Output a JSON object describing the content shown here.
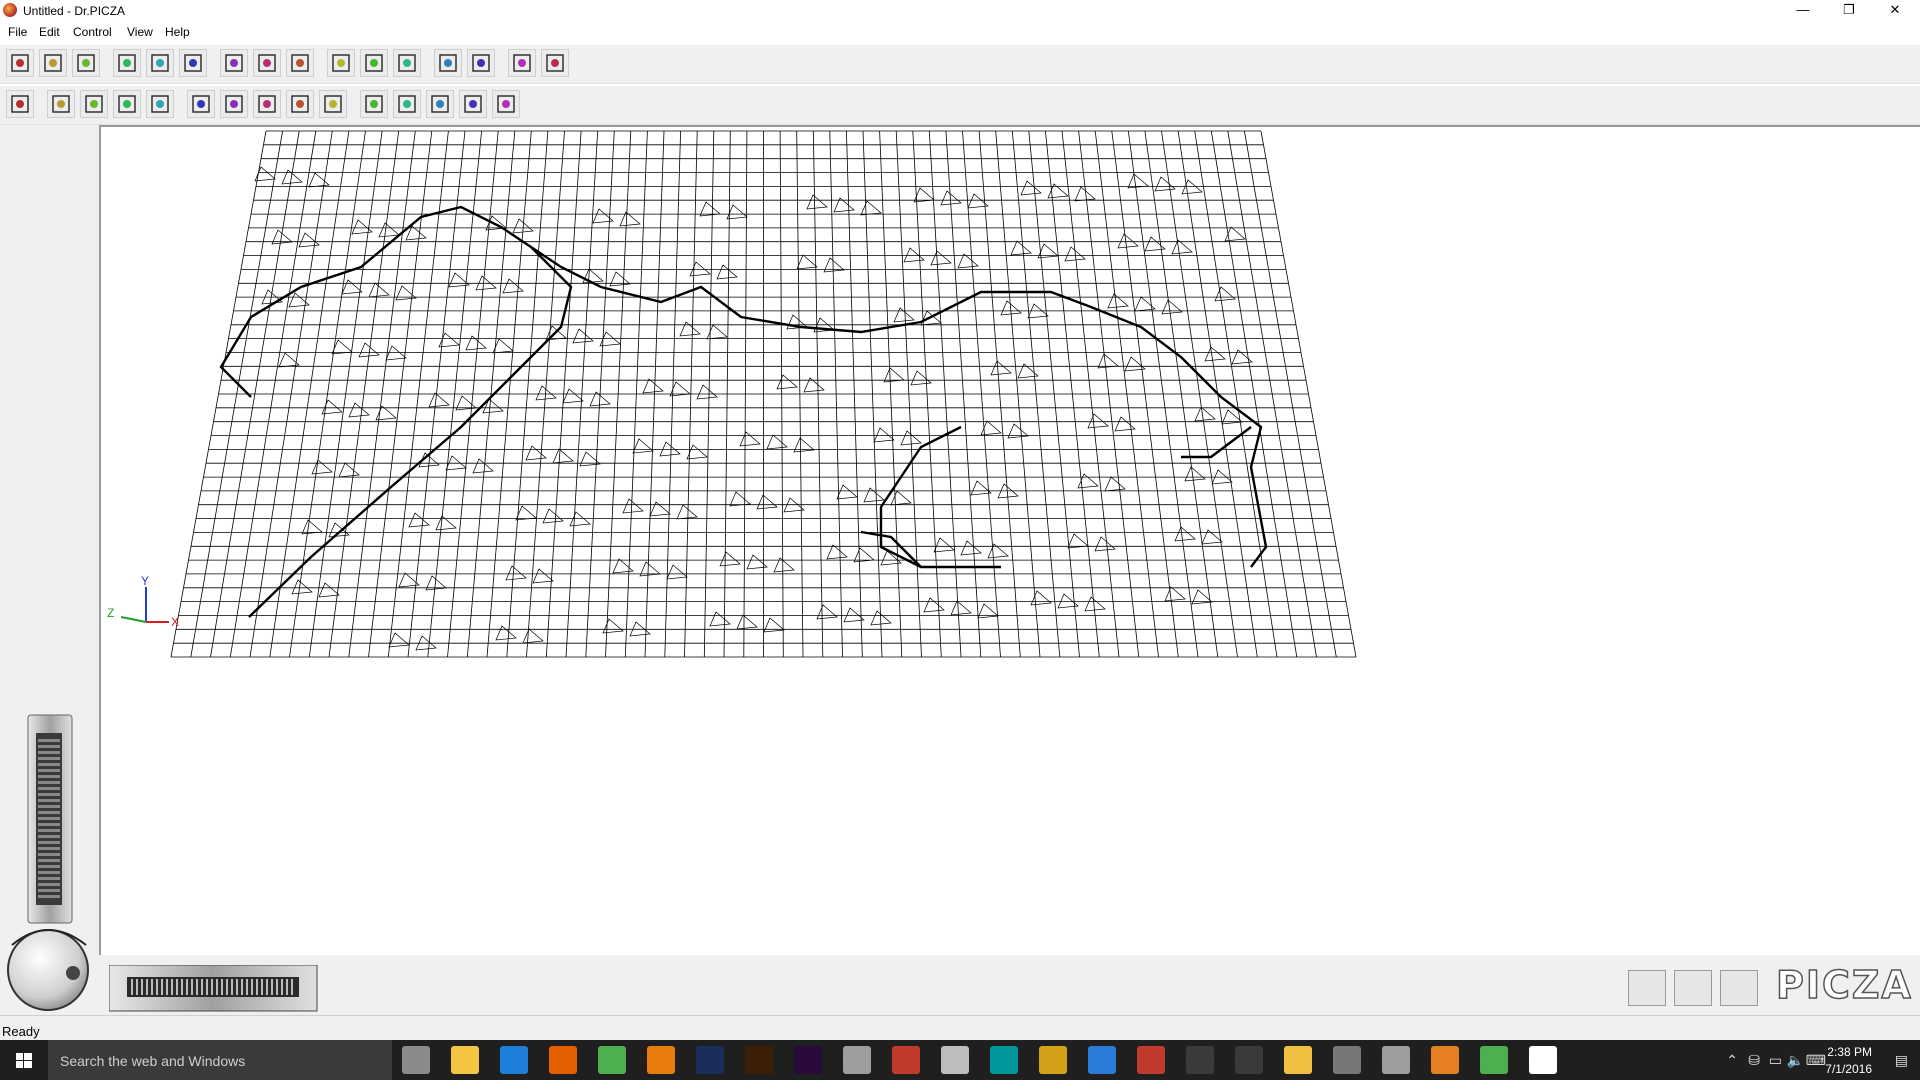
{
  "window": {
    "title": "Untitled - Dr.PICZA"
  },
  "controls": {
    "minimize": "—",
    "maximize": "❐",
    "close": "✕"
  },
  "menu": {
    "items": [
      {
        "label": "File"
      },
      {
        "label": "Edit"
      },
      {
        "label": "Control"
      },
      {
        "label": "View"
      },
      {
        "label": "Help"
      }
    ]
  },
  "toolbar_top": {
    "buttons": [
      "rotate-tool",
      "pan-tool",
      "view-3d",
      "zoom-in",
      "zoom-out",
      "zoom-fit",
      "wireframe",
      "shade-plain",
      "shade-sphere",
      "fill-tool",
      "draw-pen",
      "blank-tool",
      "layers-tool",
      "print-preview",
      "scan-tool",
      "settings-tool"
    ]
  },
  "toolbar_bottom": {
    "buttons": [
      "hand-tool",
      "select-rect",
      "zoom-select",
      "pick-tool",
      "image-tool",
      "mirror-v",
      "mirror-h",
      "curve-tool",
      "grid-tool",
      "crop-tool",
      "box-front",
      "box-side",
      "box-top",
      "box-rear",
      "box-iso"
    ]
  },
  "axes": {
    "x": "X",
    "y": "Y",
    "z": "Z"
  },
  "status": {
    "text": "Ready"
  },
  "brand": {
    "logo_text": "PICZA"
  },
  "taskbar": {
    "search_placeholder": "Search the web and Windows",
    "time": "2:38 PM",
    "date": "7/1/2016",
    "pinned": [
      {
        "name": "task-view",
        "color": "#8a8a8a"
      },
      {
        "name": "file-explorer",
        "color": "#f5c542"
      },
      {
        "name": "edge",
        "color": "#1e7fd8"
      },
      {
        "name": "firefox",
        "color": "#e66000"
      },
      {
        "name": "chrome",
        "color": "#4caf50"
      },
      {
        "name": "blender",
        "color": "#e87d0d"
      },
      {
        "name": "photoshop",
        "color": "#1b2d5a"
      },
      {
        "name": "illustrator",
        "color": "#3c1d05"
      },
      {
        "name": "premiere",
        "color": "#2a0a3a"
      },
      {
        "name": "app-badger",
        "color": "#9e9e9e"
      },
      {
        "name": "app-red",
        "color": "#c0392b"
      },
      {
        "name": "app-tools",
        "color": "#bdbdbd"
      },
      {
        "name": "arduino",
        "color": "#00979d"
      },
      {
        "name": "app-mortar",
        "color": "#d4a017"
      },
      {
        "name": "visual-studio",
        "color": "#2b7bd8"
      },
      {
        "name": "app-eagle",
        "color": "#c0392b"
      },
      {
        "name": "calculator",
        "color": "#3a3a3a"
      },
      {
        "name": "calendar",
        "color": "#3a3a3a"
      },
      {
        "name": "app-mail",
        "color": "#f0c040"
      },
      {
        "name": "app-film",
        "color": "#777777"
      },
      {
        "name": "app-badger2",
        "color": "#9e9e9e"
      },
      {
        "name": "dr-picza",
        "color": "#e67e22"
      },
      {
        "name": "chrome-2",
        "color": "#4caf50"
      },
      {
        "name": "app-settings",
        "color": "#ffffff"
      }
    ]
  }
}
